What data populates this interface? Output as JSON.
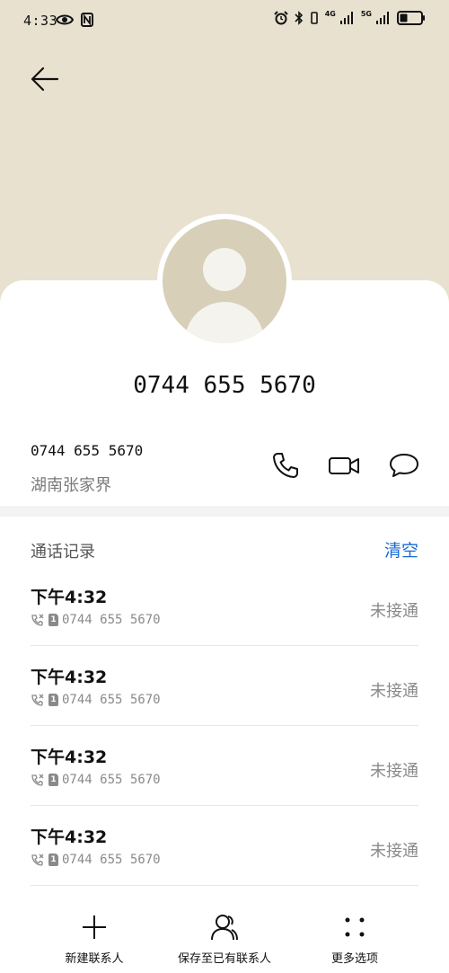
{
  "status_bar": {
    "time": "4:33",
    "network_1": "4G",
    "network_2": "5G",
    "icons": [
      "eye-icon",
      "nfc-icon",
      "alarm-icon",
      "bluetooth-icon",
      "vibrate-icon",
      "signal-icon",
      "signal-icon",
      "battery-icon"
    ]
  },
  "contact": {
    "name": "0744 655 5670",
    "number": "0744 655 5670",
    "location": "湖南张家界"
  },
  "call_log": {
    "title": "通话记录",
    "clear_label": "清空",
    "entries": [
      {
        "time": "下午4:32",
        "sim": "1",
        "number": "0744 655 5670",
        "status": "未接通"
      },
      {
        "time": "下午4:32",
        "sim": "1",
        "number": "0744 655 5670",
        "status": "未接通"
      },
      {
        "time": "下午4:32",
        "sim": "1",
        "number": "0744 655 5670",
        "status": "未接通"
      },
      {
        "time": "下午4:32",
        "sim": "1",
        "number": "0744 655 5670",
        "status": "未接通"
      }
    ]
  },
  "bottom_bar": {
    "new_contact": "新建联系人",
    "save_existing": "保存至已有联系人",
    "more_options": "更多选项"
  },
  "colors": {
    "hero_bg": "#e8e1cf",
    "avatar_bg": "#d8cfb8",
    "accent": "#1a6ad7",
    "muted_text": "#8a8a8a"
  }
}
